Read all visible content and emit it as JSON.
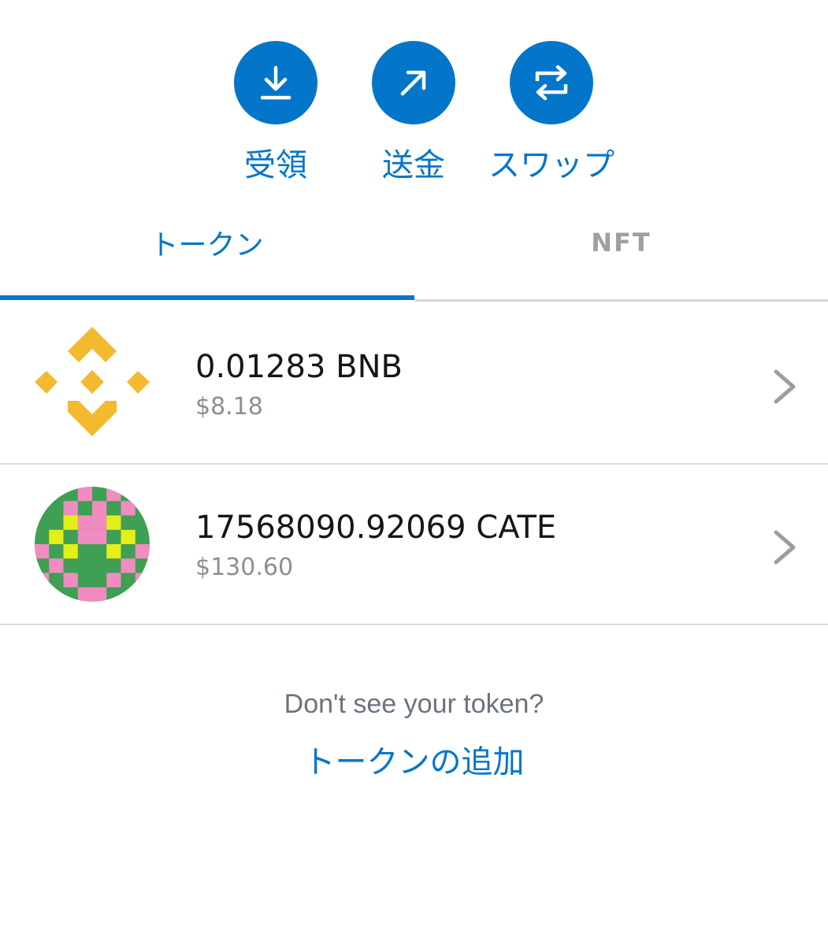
{
  "actions": {
    "receive_label": "受領",
    "send_label": "送金",
    "swap_label": "スワップ"
  },
  "tabs": {
    "tokens_label": "トークン",
    "nft_label": "NFT"
  },
  "tokens": [
    {
      "balance": "0.01283 BNB",
      "fiat": "$8.18",
      "icon": "bnb-logo-icon"
    },
    {
      "balance": "17568090.92069 CATE",
      "fiat": "$130.60",
      "icon": "cate-token-icon"
    }
  ],
  "footer": {
    "question": "Don't see your token?",
    "add_token_link": "トークンの追加"
  },
  "colors": {
    "accent": "#0376c9",
    "bnb_yellow": "#f3ba2f",
    "cate_green": "#3e9f55",
    "cate_pink": "#f08cc0",
    "cate_yellow": "#e6ee17"
  }
}
